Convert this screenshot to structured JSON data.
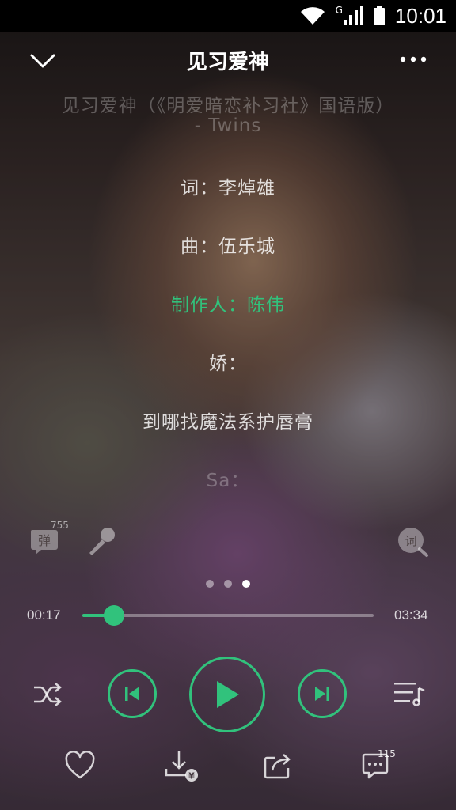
{
  "status_bar": {
    "network_type": "G",
    "time": "10:01"
  },
  "header": {
    "title": "见习爱神"
  },
  "lyrics": [
    {
      "text": "见习爱神（《明爱暗恋补习社》国语版）",
      "state": "faded"
    },
    {
      "text": "- Twins",
      "state": "faded"
    },
    {
      "text": "词：李焯雄",
      "state": "normal"
    },
    {
      "text": "曲：伍乐城",
      "state": "normal"
    },
    {
      "text": "制作人：陈伟",
      "state": "active"
    },
    {
      "text": "娇：",
      "state": "normal"
    },
    {
      "text": "到哪找魔法系护唇膏",
      "state": "normal"
    },
    {
      "text": "Sa：",
      "state": "faded"
    }
  ],
  "tools": {
    "danmu_label": "弹",
    "danmu_count": "755",
    "lyric_search_label": "词"
  },
  "pager": {
    "pages": 3,
    "current": 3
  },
  "player": {
    "elapsed": "00:17",
    "duration": "03:34",
    "progress_fraction": 0.109
  },
  "bottom": {
    "comment_count": "115"
  },
  "colors": {
    "accent": "#31c27c"
  }
}
